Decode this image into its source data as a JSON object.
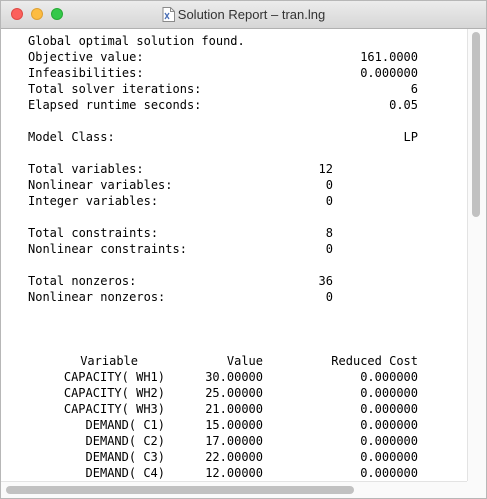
{
  "window": {
    "title": "Solution Report – tran.lng",
    "icon": "lingo-document-icon"
  },
  "report": {
    "status": "Global optimal solution found.",
    "objective_label": "Objective value:",
    "objective_value": "161.0000",
    "infeas_label": "Infeasibilities:",
    "infeas_value": "0.000000",
    "iter_label": "Total solver iterations:",
    "iter_value": "6",
    "runtime_label": "Elapsed runtime seconds:",
    "runtime_value": "0.05",
    "model_class_label": "Model Class:",
    "model_class_value": "LP",
    "total_vars_label": "Total variables:",
    "total_vars_value": "12",
    "nonlin_vars_label": "Nonlinear variables:",
    "nonlin_vars_value": "0",
    "int_vars_label": "Integer variables:",
    "int_vars_value": "0",
    "total_cons_label": "Total constraints:",
    "total_cons_value": "8",
    "nonlin_cons_label": "Nonlinear constraints:",
    "nonlin_cons_value": "0",
    "total_nz_label": "Total nonzeros:",
    "total_nz_value": "36",
    "nonlin_nz_label": "Nonlinear nonzeros:",
    "nonlin_nz_value": "0"
  },
  "table": {
    "headers": [
      "Variable",
      "Value",
      "Reduced Cost"
    ],
    "rows": [
      [
        "CAPACITY( WH1)",
        "30.00000",
        "0.000000"
      ],
      [
        "CAPACITY( WH2)",
        "25.00000",
        "0.000000"
      ],
      [
        "CAPACITY( WH3)",
        "21.00000",
        "0.000000"
      ],
      [
        "DEMAND( C1)",
        "15.00000",
        "0.000000"
      ],
      [
        "DEMAND( C2)",
        "17.00000",
        "0.000000"
      ],
      [
        "DEMAND( C3)",
        "22.00000",
        "0.000000"
      ],
      [
        "DEMAND( C4)",
        "12.00000",
        "0.000000"
      ]
    ]
  },
  "colors": {
    "close": "#fc605c",
    "minimize": "#fdbc40",
    "maximize": "#34c84a"
  }
}
